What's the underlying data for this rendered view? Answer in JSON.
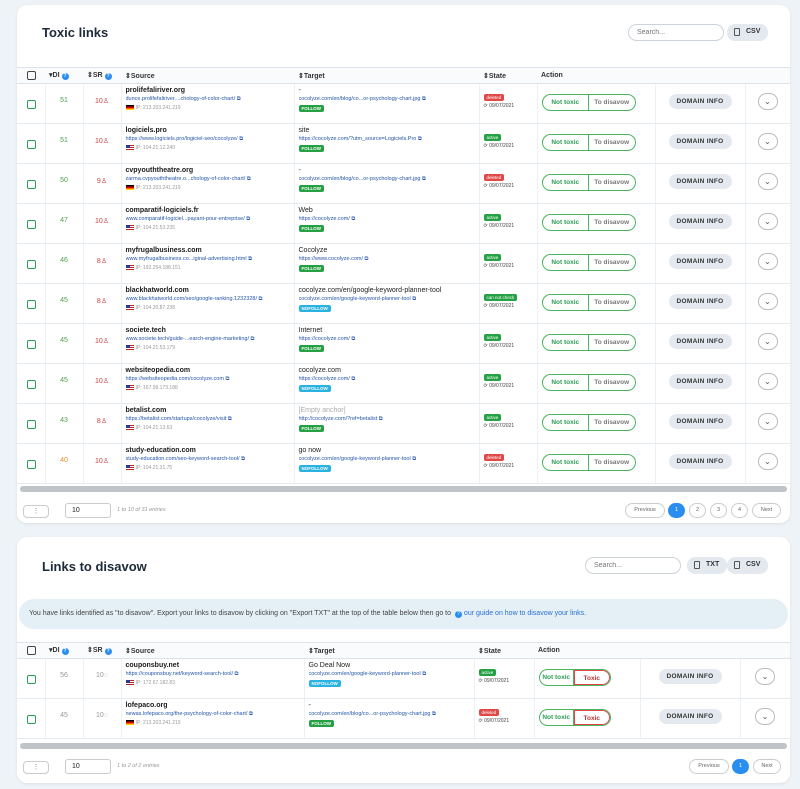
{
  "toxic": {
    "title": "Toxic links",
    "search_placeholder": "Search...",
    "csv_label": "CSV",
    "headers": {
      "di": "DI",
      "sr": "SR",
      "source": "Source",
      "target": "Target",
      "state": "State",
      "action": "Action"
    },
    "rows": [
      {
        "di": "51",
        "sr": "10",
        "domain": "prolifefaliriver.org",
        "url": "dunce.prolifefaliriver....chology-of-color-chart/",
        "flag": "de",
        "ip": "IP: 213.203.241.219",
        "anchor": "-",
        "target": "cocolyze.com/en/blog/co...or-psychology-chart.jpg",
        "link": "FOLLOW",
        "state": "deleted",
        "date": "09/07/2021",
        "di_color": "green"
      },
      {
        "di": "51",
        "sr": "10",
        "domain": "logiciels.pro",
        "url": "https://www.logiciels.pro/logiciel-seo/cocolyze/",
        "flag": "us",
        "ip": "IP: 104.21.12.240",
        "anchor": "site",
        "target": "https://cocolyze.com/?utm_source=Logiciels.Pro",
        "link": "FOLLOW",
        "state": "active",
        "date": "09/07/2021",
        "di_color": "green"
      },
      {
        "di": "50",
        "sr": "9",
        "domain": "cvpyouththeatre.org",
        "url": "zarma.cvpyouththeatre.o...chology-of-color-chart/",
        "flag": "de",
        "ip": "IP: 213.203.241.219",
        "anchor": "-",
        "target": "cocolyze.com/en/blog/co...or-psychology-chart.jpg",
        "link": "FOLLOW",
        "state": "deleted",
        "date": "09/07/2021",
        "di_color": "green"
      },
      {
        "di": "47",
        "sr": "10",
        "domain": "comparatif-logiciels.fr",
        "url": "www.comparatif-logiciel...payant-pour-entreprise/",
        "flag": "us",
        "ip": "IP: 104.21.53.235",
        "anchor": "Web",
        "target": "https://cocolyze.com/",
        "link": "FOLLOW",
        "state": "active",
        "date": "09/07/2021",
        "di_color": "green"
      },
      {
        "di": "46",
        "sr": "8",
        "domain": "myfrugalbusiness.com",
        "url": "www.myfrugalbusiness.co...iginal-advertising.html",
        "flag": "us",
        "ip": "IP: 192.254.188.151",
        "anchor": "Cocolyze",
        "target": "https://www.cocolyze.com/",
        "link": "FOLLOW",
        "state": "active",
        "date": "09/07/2021",
        "di_color": "green"
      },
      {
        "di": "45",
        "sr": "8",
        "domain": "blackhatworld.com",
        "url": "www.blackhatworld.com/seo/google-ranking.1232328/",
        "flag": "us",
        "ip": "IP: 104.20.87.238",
        "anchor": "cocolyze.com/en/google-keyword-planner-tool",
        "target": "cocolyze.com/en/google-keyword-planner-tool",
        "link": "NOFOLLOW",
        "state": "can not check",
        "date": "09/07/2021",
        "di_color": "green"
      },
      {
        "di": "45",
        "sr": "10",
        "domain": "societe.tech",
        "url": "www.societe.tech/guide-...earch-engine-marketing/",
        "flag": "us",
        "ip": "IP: 104.21.53.179",
        "anchor": "Internet",
        "target": "https://cocolyze.com/",
        "link": "FOLLOW",
        "state": "active",
        "date": "09/07/2021",
        "di_color": "green"
      },
      {
        "di": "45",
        "sr": "10",
        "domain": "websiteopedia.com",
        "url": "https://websiteopedia.com/cocolyze.com",
        "flag": "us",
        "ip": "IP: 167.99.173.188",
        "anchor": "cocolyze.com",
        "target": "https://cocolyze.com/",
        "link": "NOFOLLOW",
        "state": "active",
        "date": "09/07/2021",
        "di_color": "green"
      },
      {
        "di": "43",
        "sr": "8",
        "domain": "betalist.com",
        "url": "https://betalist.com/startups/cocolyze/visit",
        "flag": "us",
        "ip": "IP: 104.21.13.63",
        "anchor": "[Empty anchor]",
        "target": "http://cocolyze.com/?ref=betalist",
        "link": "FOLLOW",
        "state": "active",
        "date": "09/07/2021",
        "di_color": "green"
      },
      {
        "di": "40",
        "sr": "10",
        "domain": "study-education.com",
        "url": "study-education.com/seo-keyword-search-tool/",
        "flag": "us",
        "ip": "IP: 104.21.31.75",
        "anchor": "go now",
        "target": "cocolyze.com/en/google-keyword-planner-tool",
        "link": "NOFOLLOW",
        "state": "deleted",
        "date": "09/07/2021",
        "di_color": "orange"
      }
    ],
    "not_toxic": "Not toxic",
    "to_disavow": "To disavow",
    "domain_info": "DOMAIN INFO",
    "page_size": "10",
    "page_info": "1 to 10 of 31 entries",
    "prev": "Previous",
    "next": "Next",
    "pages": [
      "1",
      "2",
      "3",
      "4"
    ]
  },
  "disavow": {
    "title": "Links to disavow",
    "search_placeholder": "Search...",
    "txt_label": "TXT",
    "csv_label": "CSV",
    "info_text": "You have links identified as \"to disavow\". Export your links to disavow by clicking on \"Export TXT\" at the top of the table below then go to",
    "info_link": "our guide on how to disavow your links.",
    "rows": [
      {
        "di": "56",
        "sr": "10",
        "domain": "couponsbuy.net",
        "url": "https://couponsbuy.net/keyword-search-tool/",
        "flag": "us",
        "ip": "IP: 172.67.182.83",
        "anchor": "Go Deal Now",
        "target": "cocolyze.com/en/google-keyword-planner-tool",
        "link": "NOFOLLOW",
        "state": "active",
        "date": "09/07/2021"
      },
      {
        "di": "45",
        "sr": "10",
        "domain": "lofepaco.org",
        "url": "newas.lofepaco.org/the-psychology-of-color-chart/",
        "flag": "de",
        "ip": "IP: 213.203.241.219",
        "anchor": "-",
        "target": "cocolyze.com/en/blog/co...or-psychology-chart.jpg",
        "link": "FOLLOW",
        "state": "deleted",
        "date": "09/07/2021"
      }
    ],
    "not_toxic": "Not toxic",
    "toxic": "Toxic",
    "domain_info": "DOMAIN INFO",
    "page_size": "10",
    "page_info": "1 to 2 of 2 entries",
    "prev": "Previous",
    "next": "Next",
    "pages": [
      "1"
    ]
  }
}
